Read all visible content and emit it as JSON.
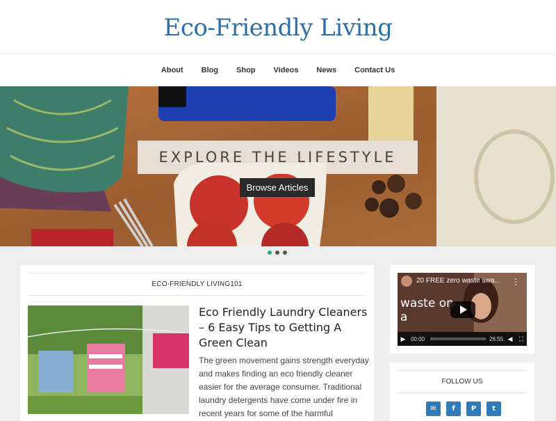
{
  "site": {
    "title": "Eco-Friendly Living"
  },
  "nav": {
    "items": [
      "About",
      "Blog",
      "Shop",
      "Videos",
      "News",
      "Contact Us"
    ]
  },
  "hero": {
    "heading": "EXPLORE THE LIFESTYLE",
    "button_label": "Browse Articles",
    "slides_total": 3,
    "active_slide": 1
  },
  "section": {
    "label": "ECO-FRIENDLY LIVING101"
  },
  "post": {
    "title": "Eco Friendly Laundry Cleaners – 6 Easy Tips to Getting A Green Clean",
    "excerpt": "The green movement gains strength everyday and makes finding an eco friendly cleaner easier for the average consumer. Traditional laundry detergents have come under fire in recent years for some of the harmful ingredients they use to"
  },
  "video": {
    "title": "20 FREE zero waste swa...",
    "overlay_text": "waste on a",
    "current_time": "00:00",
    "duration": "26:55"
  },
  "follow": {
    "label": "FOLLOW US",
    "icons": [
      "email-icon",
      "facebook-icon",
      "pinterest-icon",
      "twitter-icon"
    ]
  },
  "colors": {
    "title_blue": "#2b6ea8",
    "social_blue": "#2f7ab8",
    "active_dot": "#2aa58a"
  }
}
